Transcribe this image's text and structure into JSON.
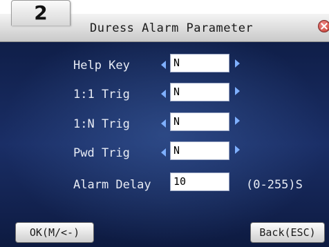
{
  "badge": {
    "number": "2"
  },
  "window": {
    "title": "Duress Alarm Parameter"
  },
  "rows": [
    {
      "label": "Help Key",
      "value": "N"
    },
    {
      "label": "1:1 Trig",
      "value": "N"
    },
    {
      "label": "1:N Trig",
      "value": "N"
    },
    {
      "label": "Pwd Trig",
      "value": "N"
    }
  ],
  "alarm_delay": {
    "label": "Alarm Delay",
    "value": "10",
    "range": "(0-255)S"
  },
  "buttons": {
    "ok": "OK(M/<-)",
    "back": "Back(ESC)"
  },
  "icons": {
    "close": "close-icon",
    "left": "left-arrow-icon",
    "right": "right-arrow-icon"
  },
  "colors": {
    "panel_bg": "#1a2e66",
    "accent_arrow": "#7fb0ff",
    "close": "#c0392b"
  }
}
